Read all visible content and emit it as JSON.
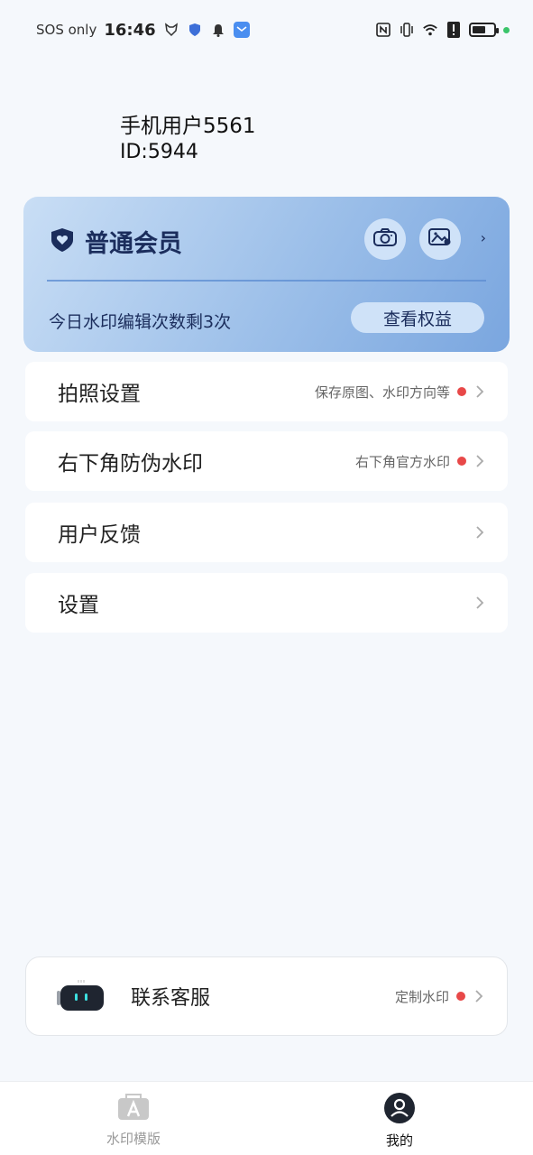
{
  "status_bar": {
    "carrier": "SOS only",
    "time": "16:46",
    "icons": [
      "fox-icon",
      "shield-icon",
      "bell-icon",
      "mail-app-icon",
      "nfc-icon",
      "vibrate-icon",
      "wifi-icon",
      "alert-icon",
      "battery-icon"
    ]
  },
  "profile": {
    "name": "手机用户5561",
    "id": "ID:5944"
  },
  "member_card": {
    "title": "普通会员",
    "quota_text": "今日水印编辑次数剩3次",
    "benefits_button": "查看权益",
    "chevron": "›",
    "colors": {
      "primary": "#1b2d5c",
      "gradient_start": "#c9def5",
      "gradient_end": "#7aa6df"
    }
  },
  "menu": {
    "items": [
      {
        "title": "拍照设置",
        "hint": "保存原图、水印方向等",
        "has_dot": true
      },
      {
        "title": "右下角防伪水印",
        "hint": "右下角官方水印",
        "has_dot": true
      },
      {
        "title": "用户反馈",
        "hint": "",
        "has_dot": false
      },
      {
        "title": "设置",
        "hint": "",
        "has_dot": false
      }
    ]
  },
  "service": {
    "title": "联系客服",
    "hint": "定制水印"
  },
  "bottom_nav": {
    "tabs": [
      {
        "label": "水印模版",
        "active": false
      },
      {
        "label": "我的",
        "active": true
      }
    ]
  }
}
